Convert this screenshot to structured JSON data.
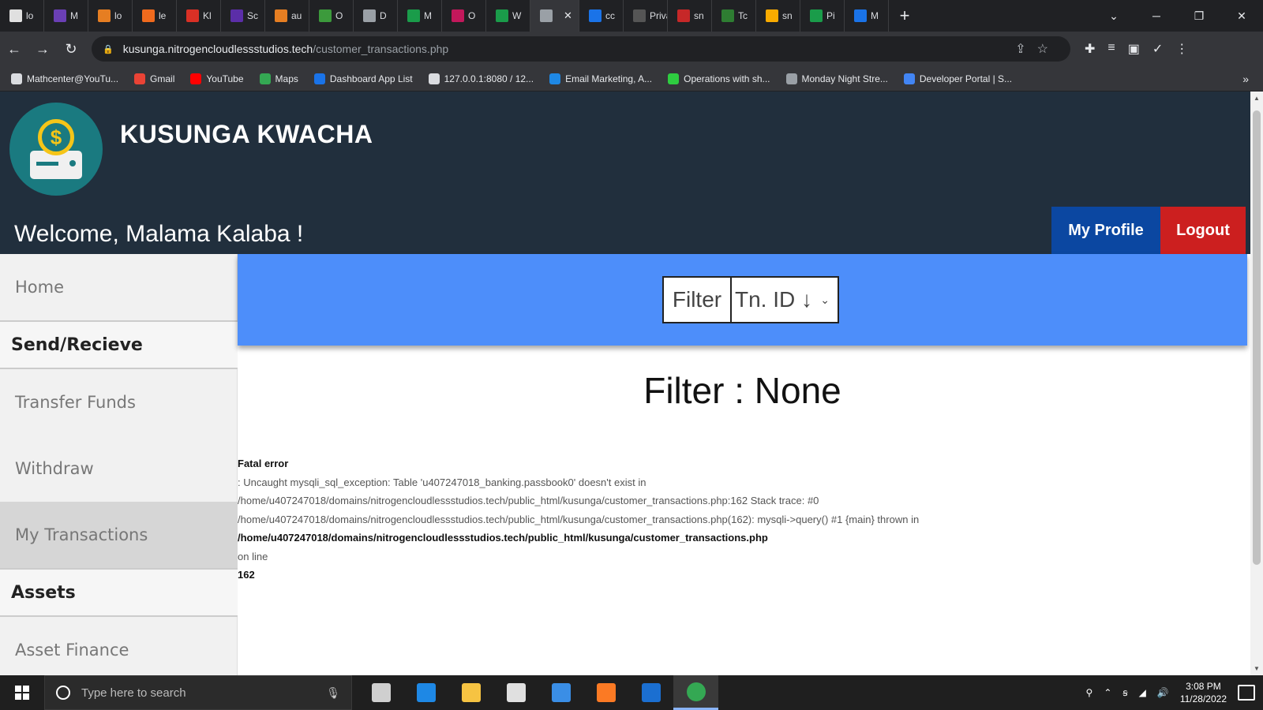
{
  "browser": {
    "tabs": [
      {
        "label": "lo",
        "color": "#e0e0e0"
      },
      {
        "label": "M",
        "color": "#6a3fb5"
      },
      {
        "label": "lo",
        "color": "#e67e22"
      },
      {
        "label": "le",
        "color": "#f06a1d"
      },
      {
        "label": "Kl",
        "color": "#d93025"
      },
      {
        "label": "Sc",
        "color": "#5b2ea8"
      },
      {
        "label": "au",
        "color": "#e67e22"
      },
      {
        "label": "O",
        "color": "#3c9a3c"
      },
      {
        "label": "D",
        "color": "#9aa0a6"
      },
      {
        "label": "M",
        "color": "#1a9c4a"
      },
      {
        "label": "O",
        "color": "#c2185b"
      },
      {
        "label": "W",
        "color": "#1a9c4a"
      },
      {
        "label": "",
        "color": "#9aa0a6",
        "active": true
      },
      {
        "label": "cc",
        "color": "#1a73e8"
      },
      {
        "label": "Privac",
        "color": "#555555"
      },
      {
        "label": "sn",
        "color": "#c62828"
      },
      {
        "label": "Tc",
        "color": "#2e7d32"
      },
      {
        "label": "sn",
        "color": "#f9ab00"
      },
      {
        "label": "Pi",
        "color": "#1a9c4a"
      },
      {
        "label": "M",
        "color": "#1a73e8"
      }
    ],
    "url_domain": "kusunga.nitrogencloudlessstudios.tech",
    "url_path": "/customer_transactions.php",
    "bookmarks": [
      {
        "label": "Mathcenter@YouTu...",
        "color": "#dadce0"
      },
      {
        "label": "Gmail",
        "color": "#ea4335"
      },
      {
        "label": "YouTube",
        "color": "#ff0000"
      },
      {
        "label": "Maps",
        "color": "#34a853"
      },
      {
        "label": "Dashboard App List",
        "color": "#1a73e8"
      },
      {
        "label": "127.0.0.1:8080 / 12...",
        "color": "#dadce0"
      },
      {
        "label": "Email Marketing, A...",
        "color": "#1e88e5"
      },
      {
        "label": "Operations with sh...",
        "color": "#2ecc40"
      },
      {
        "label": "Monday Night Stre...",
        "color": "#9aa0a6"
      },
      {
        "label": "Developer Portal | S...",
        "color": "#4285f4"
      }
    ]
  },
  "header": {
    "brand": "KUSUNGA KWACHA",
    "welcome": "Welcome,  Malama Kalaba !",
    "logo_symbol": "$",
    "profile_label": "My Profile",
    "logout_label": "Logout"
  },
  "sidebar": {
    "home": "Home",
    "section_send": "Send/Recieve",
    "transfer": "Transfer Funds",
    "withdraw": "Withdraw",
    "transactions": "My Transactions",
    "section_assets": "Assets",
    "asset_finance": "Asset Finance"
  },
  "filter": {
    "label": "Filter",
    "selected": "Tn. ID ↓",
    "title": "Filter : None"
  },
  "error": {
    "heading": "Fatal error",
    "line1": ": Uncaught mysqli_sql_exception: Table 'u407247018_banking.passbook0' doesn't exist in",
    "line2": "/home/u407247018/domains/nitrogencloudlessstudios.tech/public_html/kusunga/customer_transactions.php:162 Stack trace: #0",
    "line3": "/home/u407247018/domains/nitrogencloudlessstudios.tech/public_html/kusunga/customer_transactions.php(162): mysqli->query() #1 {main} thrown in",
    "line4": "/home/u407247018/domains/nitrogencloudlessstudios.tech/public_html/kusunga/customer_transactions.php",
    "line5": "on line",
    "line6": "162"
  },
  "taskbar": {
    "search_placeholder": "Type here to search",
    "time": "3:08 PM",
    "date": "11/28/2022",
    "icons": [
      {
        "name": "task-view",
        "color": "#cfcfcf"
      },
      {
        "name": "edge",
        "color": "#1e88e5"
      },
      {
        "name": "file-explorer",
        "color": "#f6c342"
      },
      {
        "name": "store",
        "color": "#e0e0e0"
      },
      {
        "name": "mail",
        "color": "#3a8ee6"
      },
      {
        "name": "xampp",
        "color": "#fb7a24"
      },
      {
        "name": "app",
        "color": "#1b6fd1"
      },
      {
        "name": "chrome",
        "color": "#34a853"
      }
    ]
  }
}
